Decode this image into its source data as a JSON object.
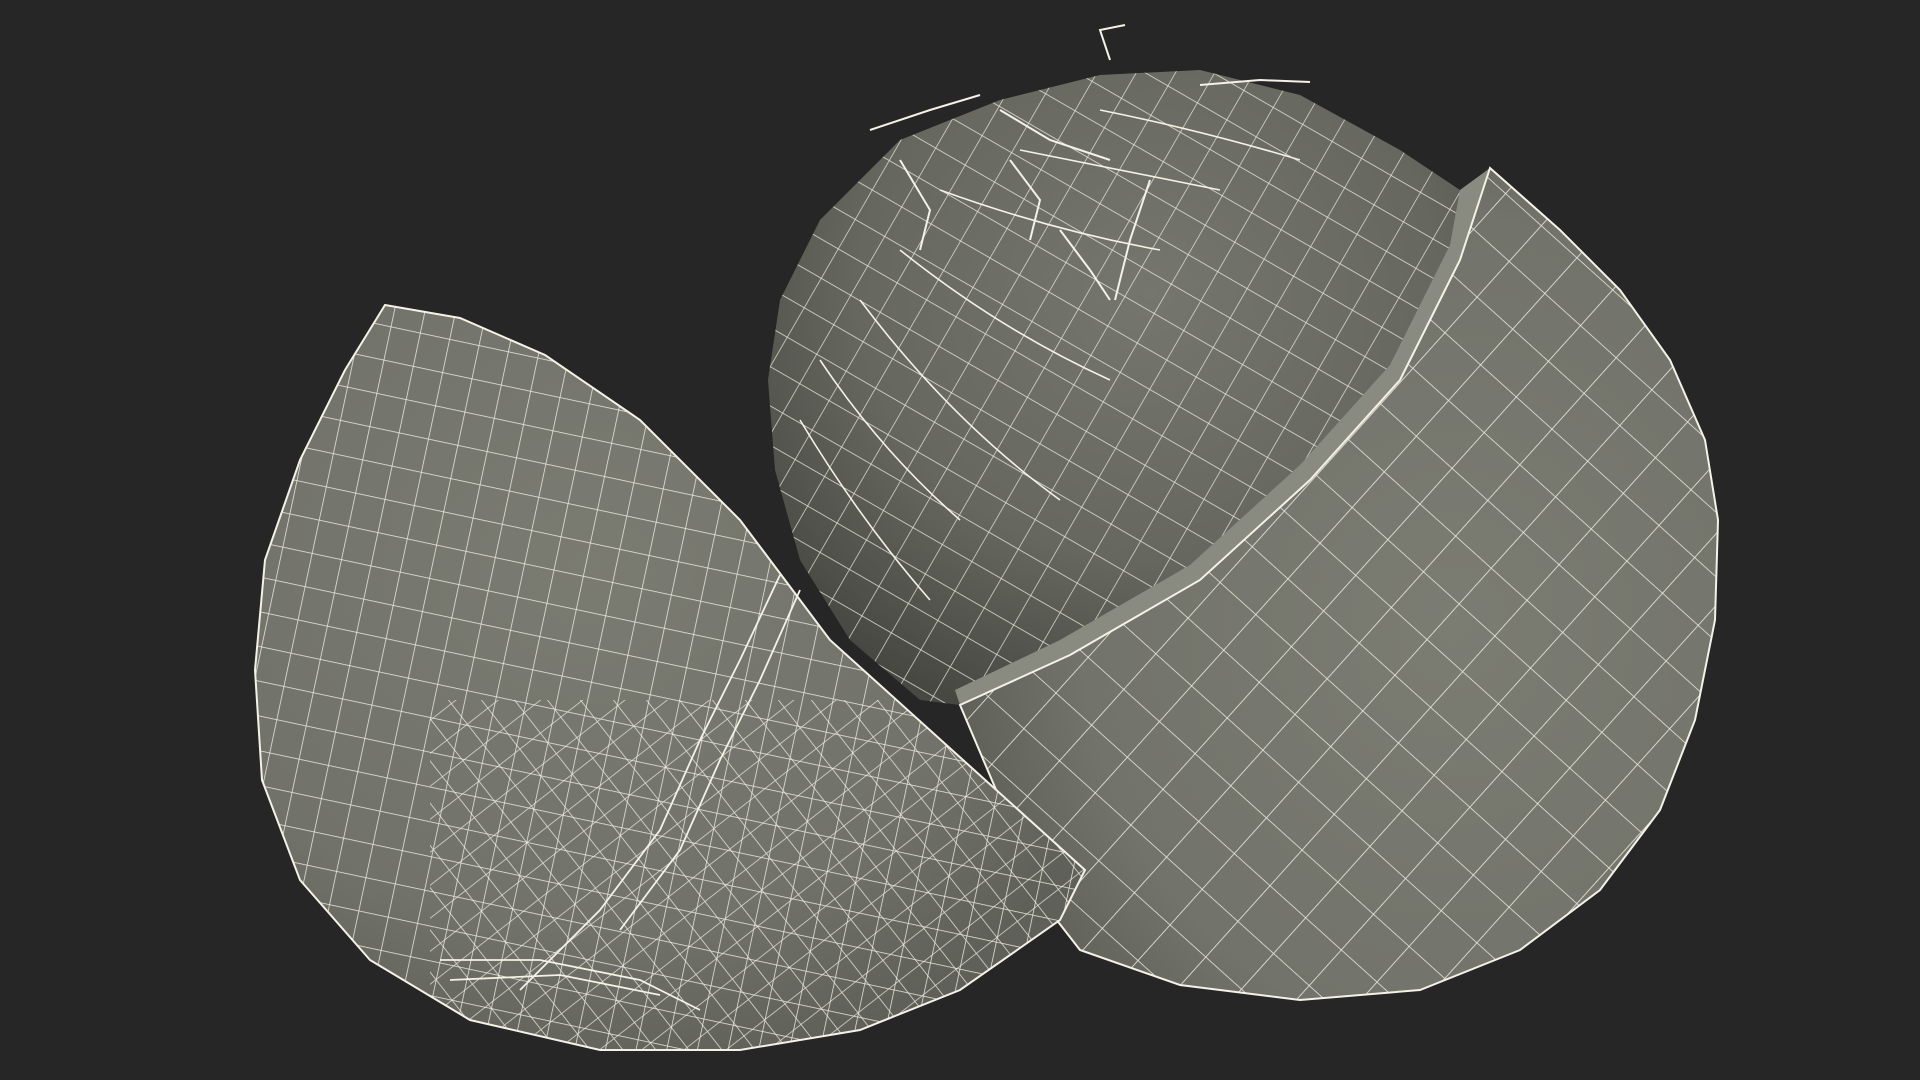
{
  "scene": {
    "background_color": "#262626",
    "mesh_surface_color": "#73746a",
    "mesh_shadow_color": "#4f514a",
    "wireframe_color": "#f4f1e6",
    "objects": [
      {
        "name": "wireframe-fruit-half",
        "description_icon": "mesh-object"
      },
      {
        "name": "wireframe-fruit-opened",
        "description_icon": "mesh-object"
      }
    ]
  }
}
